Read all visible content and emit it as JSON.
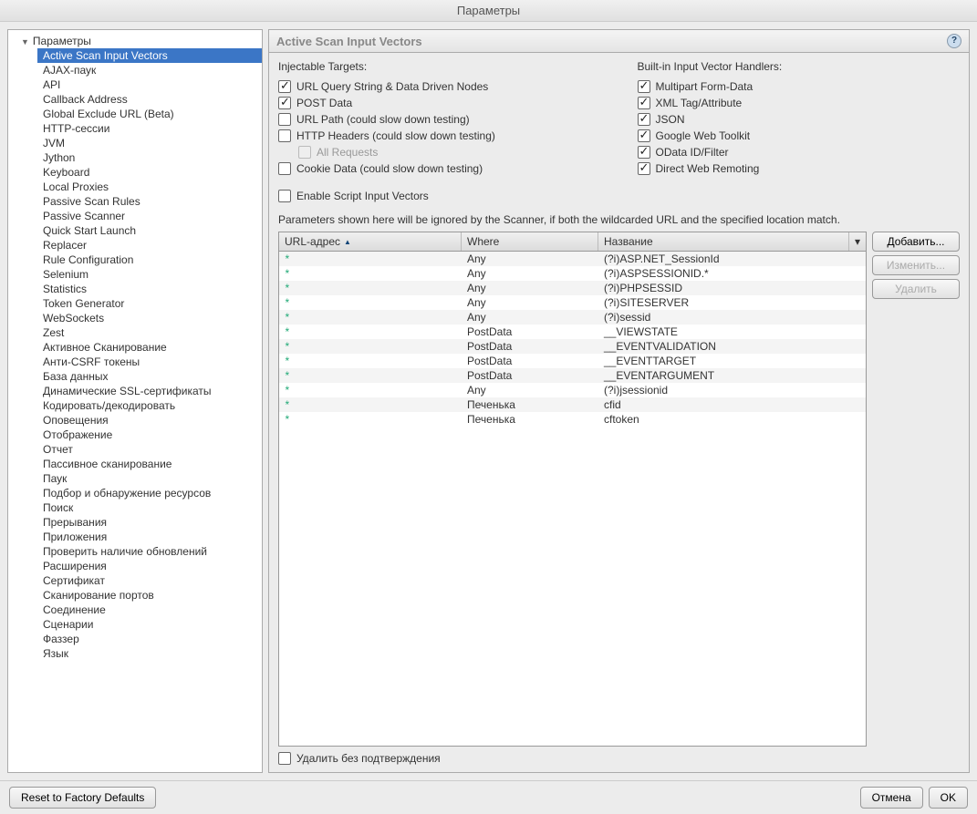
{
  "window": {
    "title": "Параметры"
  },
  "sidebar": {
    "root_label": "Параметры",
    "items": [
      {
        "label": "Active Scan Input Vectors",
        "selected": true
      },
      {
        "label": "AJAX-паук"
      },
      {
        "label": "API"
      },
      {
        "label": "Callback Address"
      },
      {
        "label": "Global Exclude URL (Beta)"
      },
      {
        "label": "HTTP-сессии"
      },
      {
        "label": "JVM"
      },
      {
        "label": "Jython"
      },
      {
        "label": "Keyboard"
      },
      {
        "label": "Local Proxies"
      },
      {
        "label": "Passive Scan Rules"
      },
      {
        "label": "Passive Scanner"
      },
      {
        "label": "Quick Start Launch"
      },
      {
        "label": "Replacer"
      },
      {
        "label": "Rule Configuration"
      },
      {
        "label": "Selenium"
      },
      {
        "label": "Statistics"
      },
      {
        "label": "Token Generator"
      },
      {
        "label": "WebSockets"
      },
      {
        "label": "Zest"
      },
      {
        "label": "Активное Сканирование"
      },
      {
        "label": "Анти-CSRF токены"
      },
      {
        "label": "База данных"
      },
      {
        "label": "Динамические SSL-сертификаты"
      },
      {
        "label": "Кодировать/декодировать"
      },
      {
        "label": "Оповещения"
      },
      {
        "label": "Отображение"
      },
      {
        "label": "Отчет"
      },
      {
        "label": "Пассивное сканирование"
      },
      {
        "label": "Паук"
      },
      {
        "label": "Подбор и обнаружение ресурсов"
      },
      {
        "label": "Поиск"
      },
      {
        "label": "Прерывания"
      },
      {
        "label": "Приложения"
      },
      {
        "label": "Проверить наличие обновлений"
      },
      {
        "label": "Расширения"
      },
      {
        "label": "Сертификат"
      },
      {
        "label": "Сканирование портов"
      },
      {
        "label": "Соединение"
      },
      {
        "label": "Сценарии"
      },
      {
        "label": "Фаззер"
      },
      {
        "label": "Язык"
      }
    ]
  },
  "panel": {
    "title": "Active Scan Input Vectors",
    "injectable_title": "Injectable Targets:",
    "builtin_title": "Built-in Input Vector Handlers:",
    "injectable": [
      {
        "label": "URL Query String & Data Driven Nodes",
        "checked": true
      },
      {
        "label": "POST Data",
        "checked": true
      },
      {
        "label": "URL Path (could slow down testing)",
        "checked": false
      },
      {
        "label": "HTTP Headers (could slow down testing)",
        "checked": false
      },
      {
        "label": "All Requests",
        "checked": false,
        "indent": true,
        "disabled": true
      },
      {
        "label": "Cookie Data (could slow down testing)",
        "checked": false
      }
    ],
    "builtin": [
      {
        "label": "Multipart Form-Data",
        "checked": true
      },
      {
        "label": "XML Tag/Attribute",
        "checked": true
      },
      {
        "label": "JSON",
        "checked": true
      },
      {
        "label": "Google Web Toolkit",
        "checked": true
      },
      {
        "label": "OData ID/Filter",
        "checked": true
      },
      {
        "label": "Direct Web Remoting",
        "checked": true
      }
    ],
    "enable_script": {
      "label": "Enable Script Input Vectors",
      "checked": false
    },
    "ignore_note": "Parameters shown here will be ignored by the Scanner, if both the wildcarded URL and the specified location match.",
    "table": {
      "columns": [
        "URL-адрес",
        "Where",
        "Название"
      ],
      "sort_indicator": "▲",
      "rows": [
        {
          "url": "*",
          "where": "Any",
          "name": "(?i)ASP.NET_SessionId"
        },
        {
          "url": "*",
          "where": "Any",
          "name": "(?i)ASPSESSIONID.*"
        },
        {
          "url": "*",
          "where": "Any",
          "name": "(?i)PHPSESSID"
        },
        {
          "url": "*",
          "where": "Any",
          "name": "(?i)SITESERVER"
        },
        {
          "url": "*",
          "where": "Any",
          "name": "(?i)sessid"
        },
        {
          "url": "*",
          "where": "PostData",
          "name": "__VIEWSTATE"
        },
        {
          "url": "*",
          "where": "PostData",
          "name": "__EVENTVALIDATION"
        },
        {
          "url": "*",
          "where": "PostData",
          "name": "__EVENTTARGET"
        },
        {
          "url": "*",
          "where": "PostData",
          "name": "__EVENTARGUMENT"
        },
        {
          "url": "*",
          "where": "Any",
          "name": "(?i)jsessionid"
        },
        {
          "url": "*",
          "where": "Печенька",
          "name": "cfid"
        },
        {
          "url": "*",
          "where": "Печенька",
          "name": "cftoken"
        }
      ]
    },
    "buttons": {
      "add": "Добавить...",
      "edit": "Изменить...",
      "delete": "Удалить"
    },
    "delete_confirm": {
      "label": "Удалить без подтверждения",
      "checked": false
    }
  },
  "footer": {
    "reset": "Reset to Factory Defaults",
    "cancel": "Отмена",
    "ok": "OK"
  }
}
